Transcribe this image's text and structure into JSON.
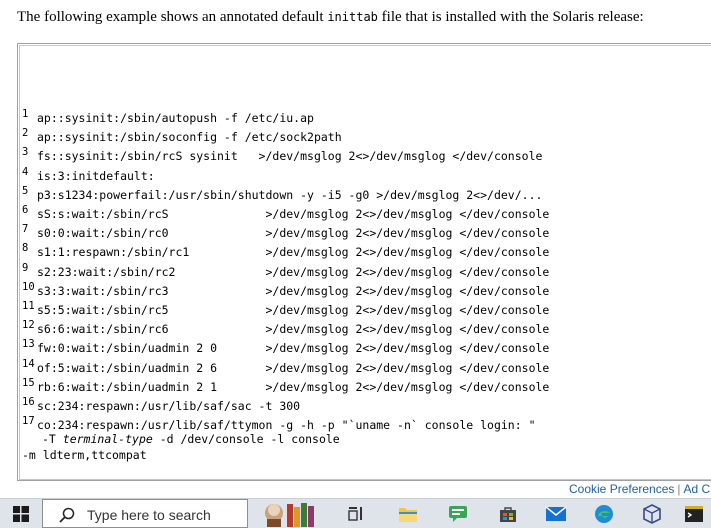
{
  "intro": {
    "before": "The following example shows an annotated default ",
    "code": "inittab",
    "after": " file that is installed with the Solaris release:"
  },
  "code_lines": [
    {
      "n": "1",
      "t": "ap::sysinit:/sbin/autopush -f /etc/iu.ap"
    },
    {
      "n": "2",
      "t": "ap::sysinit:/sbin/soconfig -f /etc/sock2path"
    },
    {
      "n": "3",
      "t": "fs::sysinit:/sbin/rcS sysinit   >/dev/msglog 2<>/dev/msglog </dev/console"
    },
    {
      "n": "4",
      "t": "is:3:initdefault:"
    },
    {
      "n": "5",
      "t": "p3:s1234:powerfail:/usr/sbin/shutdown -y -i5 -g0 >/dev/msglog 2<>/dev/..."
    },
    {
      "n": "6",
      "t": "sS:s:wait:/sbin/rcS              >/dev/msglog 2<>/dev/msglog </dev/console"
    },
    {
      "n": "7",
      "t": "s0:0:wait:/sbin/rc0              >/dev/msglog 2<>/dev/msglog </dev/console"
    },
    {
      "n": "8",
      "t": "s1:1:respawn:/sbin/rc1           >/dev/msglog 2<>/dev/msglog </dev/console"
    },
    {
      "n": "9",
      "t": "s2:23:wait:/sbin/rc2             >/dev/msglog 2<>/dev/msglog </dev/console"
    },
    {
      "n": "10",
      "t": "s3:3:wait:/sbin/rc3              >/dev/msglog 2<>/dev/msglog </dev/console"
    },
    {
      "n": "11",
      "t": "s5:5:wait:/sbin/rc5              >/dev/msglog 2<>/dev/msglog </dev/console"
    },
    {
      "n": "12",
      "t": "s6:6:wait:/sbin/rc6              >/dev/msglog 2<>/dev/msglog </dev/console"
    },
    {
      "n": "13",
      "t": "fw:0:wait:/sbin/uadmin 2 0       >/dev/msglog 2<>/dev/msglog </dev/console"
    },
    {
      "n": "14",
      "t": "of:5:wait:/sbin/uadmin 2 6       >/dev/msglog 2<>/dev/msglog </dev/console"
    },
    {
      "n": "15",
      "t": "rb:6:wait:/sbin/uadmin 2 1       >/dev/msglog 2<>/dev/msglog </dev/console"
    },
    {
      "n": "16",
      "t": "sc:234:respawn:/usr/lib/saf/sac -t 300"
    },
    {
      "n": "17",
      "t": "co:234:respawn:/usr/lib/saf/ttymon -g -h -p \"`uname -n` console login: \""
    }
  ],
  "continuation": {
    "prefix": "-T ",
    "italic": "terminal-type",
    "suffix": " -d /dev/console -l console"
  },
  "last_line": "-m ldterm,ttcompat",
  "footer": {
    "cookie": "Cookie Preferences",
    "sep": "|",
    "ad": "Ad C"
  },
  "taskbar": {
    "search_placeholder": "Type here to search"
  },
  "colors": {
    "taskbar_bg": "#dfe3ea",
    "link": "#1f5fa8"
  }
}
